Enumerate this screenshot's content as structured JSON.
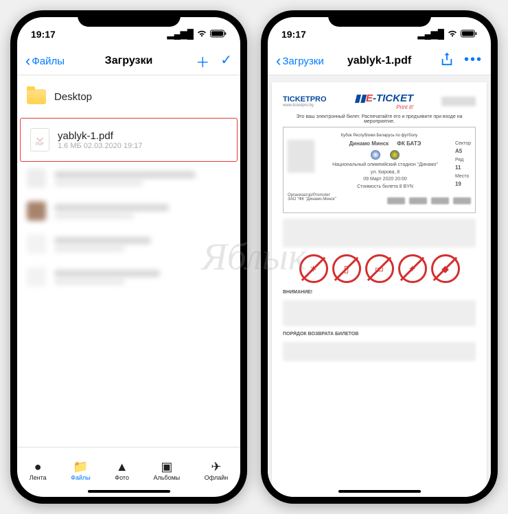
{
  "statusbar": {
    "time": "19:17"
  },
  "left": {
    "back_label": "Файлы",
    "title": "Загрузки",
    "folder": {
      "name": "Desktop"
    },
    "file": {
      "name": "yablyk-1.pdf",
      "meta": "1.6 МБ  02.03.2020 19:17"
    },
    "tabs": {
      "feed": "Лента",
      "files": "Файлы",
      "photo": "Фото",
      "albums": "Альбомы",
      "offline": "Офлайн"
    }
  },
  "right": {
    "back_label": "Загрузки",
    "title": "yablyk-1.pdf",
    "doc": {
      "ticketpro": "TICKETPRO",
      "ticketpro_url": "www.ticketpro.by",
      "eticket_prefix": "E",
      "eticket_rest": "-TICKET",
      "printit": "Print it!",
      "subtitle": "Это ваш электронный билет. Распечатайте его и предъявите при входе на мероприятие.",
      "cup": "Кубок Республики Беларусь по футболу",
      "team1": "Динамо Минск",
      "team2": "ФК БАТЭ",
      "venue": "Национальный олимпийский стадион \"Динамо\"",
      "address": "ул. Кирова, 8",
      "date": "09 Март 2020 20:00",
      "price": "Стоимость билета   8   BYN",
      "seat_sector_l": "Сектор",
      "seat_sector_v": "A5",
      "seat_row_l": "Ряд",
      "seat_row_v": "11",
      "seat_place_l": "Место",
      "seat_place_v": "19",
      "org_l": "Организатор/Promoter",
      "org_v": "ЗАО \"ФК \"Динамо-Минск\"",
      "warn": "ВНИМАНИЕ!",
      "refund": "ПОРЯДОК ВОЗВРАТА БИЛЕТОВ"
    }
  },
  "watermark": "Яблык"
}
